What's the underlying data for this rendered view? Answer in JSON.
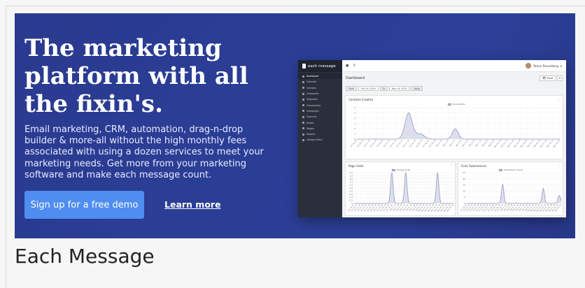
{
  "hero": {
    "title": "The marketing platform with all the fixin's.",
    "description": "Email marketing, CRM, automation, drag-n-drop builder & more-all without the high monthly fees associated with using a dozen services to meet your marketing needs. Get more from your marketing software and make each message count.",
    "cta_label": "Sign up for a free demo",
    "learn_more_label": "Learn more",
    "colors": {
      "background": "#2b3d95",
      "cta": "#4f8df0"
    }
  },
  "caption": "Each Message",
  "app": {
    "brand": "each message",
    "user_name": "Steve Rosenberg",
    "header_icons": [
      "bell-icon",
      "search-icon"
    ],
    "page_title": "Dashboard",
    "save_label": "Save",
    "filter": {
      "from_label": "From",
      "from_value": "Oct 19, 2019",
      "to_label": "To",
      "to_value": "Nov 19, 2019",
      "apply_label": "Apply"
    },
    "sidebar": [
      {
        "label": "Dashboard",
        "icon": "dashboard-icon",
        "active": true,
        "chevron": false
      },
      {
        "label": "Calendar",
        "icon": "calendar-icon",
        "active": false,
        "chevron": false
      },
      {
        "label": "Contacts",
        "icon": "contacts-icon",
        "active": false,
        "chevron": false
      },
      {
        "label": "Companies",
        "icon": "companies-icon",
        "active": false,
        "chevron": false
      },
      {
        "label": "Segments",
        "icon": "segments-icon",
        "active": false,
        "chevron": false
      },
      {
        "label": "Components",
        "icon": "components-icon",
        "active": false,
        "chevron": true
      },
      {
        "label": "Campaigns",
        "icon": "campaigns-icon",
        "active": false,
        "chevron": false
      },
      {
        "label": "Channels",
        "icon": "channels-icon",
        "active": false,
        "chevron": true
      },
      {
        "label": "Assets",
        "icon": "assets-icon",
        "active": false,
        "chevron": true
      },
      {
        "label": "Stages",
        "icon": "stages-icon",
        "active": false,
        "chevron": false
      },
      {
        "label": "Reports",
        "icon": "reports-icon",
        "active": false,
        "chevron": false
      },
      {
        "label": "Collapse Menu",
        "icon": "collapse-icon",
        "active": false,
        "chevron": false
      }
    ],
    "panels": {
      "contacts_created": {
        "title": "Contacts Created",
        "legend": "All contacts",
        "y_ticks": [
          "6",
          "5",
          "4",
          "3",
          "2",
          "1",
          "0"
        ]
      },
      "page_visits": {
        "title": "Page Visits",
        "legend": "Unique visits",
        "y_ticks": [
          "2.0",
          "1.8",
          "1.6",
          "1.4",
          "1.2",
          "1.0",
          "0.8",
          "0.6",
          "0.4",
          "0.2",
          "0"
        ]
      },
      "form_submissions": {
        "title": "Form Submissions",
        "legend": "Submission Count",
        "y_ticks": [
          "25",
          "20",
          "15",
          "10",
          "5",
          "0"
        ]
      }
    },
    "x_dates": [
      "Oct 19, 19",
      "Oct 20, 19",
      "Oct 21, 19",
      "Oct 22, 19",
      "Oct 23, 19",
      "Oct 24, 19",
      "Oct 25, 19",
      "Oct 26, 19",
      "Oct 27, 19",
      "Oct 28, 19",
      "Oct 29, 19",
      "Oct 30, 19",
      "Oct 31, 19",
      "Nov 1, 19",
      "Nov 2, 19",
      "Nov 3, 19",
      "Nov 4, 19",
      "Nov 5, 19",
      "Nov 6, 19",
      "Nov 7, 19",
      "Nov 8, 19",
      "Nov 9, 19",
      "Nov 10, 19",
      "Nov 11, 19",
      "Nov 12, 19",
      "Nov 13, 19",
      "Nov 14, 19",
      "Nov 15, 19",
      "Nov 16, 19",
      "Nov 17, 19",
      "Nov 18, 19",
      "Nov 19, 19"
    ]
  }
}
